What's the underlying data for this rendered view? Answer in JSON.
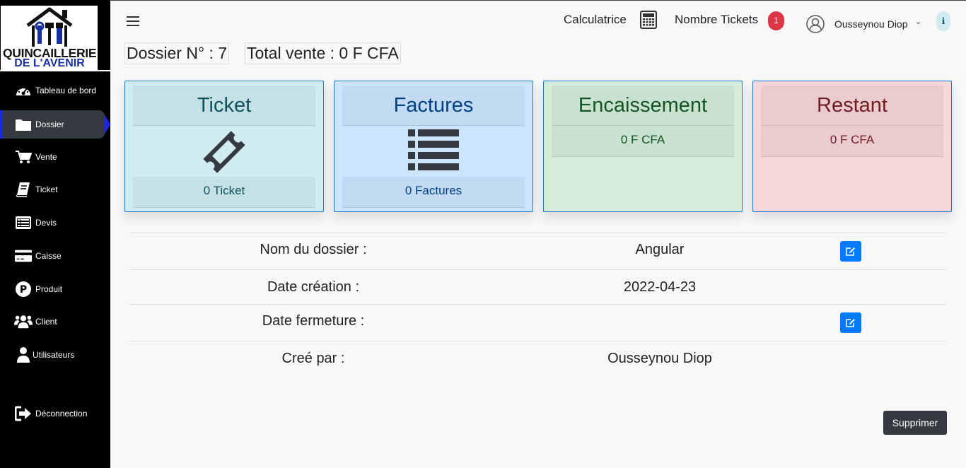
{
  "sidebar": {
    "logo": {
      "line1": "QUINCAILLERIE",
      "line2": "DE L'AVENIR"
    },
    "items": [
      {
        "label": "Tableau de bord",
        "icon": "dashboard-icon"
      },
      {
        "label": "Dossier",
        "icon": "folder-icon",
        "active": true
      },
      {
        "label": "Vente",
        "icon": "cart-icon"
      },
      {
        "label": "Ticket",
        "icon": "book-icon"
      },
      {
        "label": "Devis",
        "icon": "list-alt-icon"
      },
      {
        "label": "Caisse",
        "icon": "credit-card-icon"
      },
      {
        "label": "Produit",
        "icon": "parking-icon"
      },
      {
        "label": "Client",
        "icon": "users-icon"
      },
      {
        "label": "Utilisateurs",
        "icon": "user-icon"
      }
    ],
    "logout": {
      "label": "Déconnection",
      "icon": "sign-out-icon"
    }
  },
  "topbar": {
    "calculator_label": "Calculatrice",
    "tickets_label": "Nombre Tickets",
    "tickets_count": "1",
    "user_name": "Ousseynou Diop",
    "info_glyph": "i"
  },
  "header": {
    "dossier_number": "Dossier N° : 7",
    "total_sales": "Total vente : 0 F CFA"
  },
  "cards": {
    "ticket": {
      "title": "Ticket",
      "footer": "0 Ticket"
    },
    "factures": {
      "title": "Factures",
      "footer": "0 Factures"
    },
    "encaissement": {
      "title": "Encaissement",
      "amount": "0 F CFA"
    },
    "restant": {
      "title": "Restant",
      "amount": "0 F CFA"
    }
  },
  "details": {
    "name": {
      "label": "Nom du dossier :",
      "value": "Angular"
    },
    "created": {
      "label": "Date création :",
      "value": "2022-04-23"
    },
    "closed": {
      "label": "Date fermeture :",
      "value": ""
    },
    "author": {
      "label": "Creé par :",
      "value": "Ousseynou Diop"
    }
  },
  "actions": {
    "delete_label": "Supprimer"
  },
  "colors": {
    "sidebar_bg": "#000000",
    "active_marker": "#1a26e0",
    "primary": "#007bff",
    "danger": "#dc3545",
    "dark": "#343a40"
  }
}
